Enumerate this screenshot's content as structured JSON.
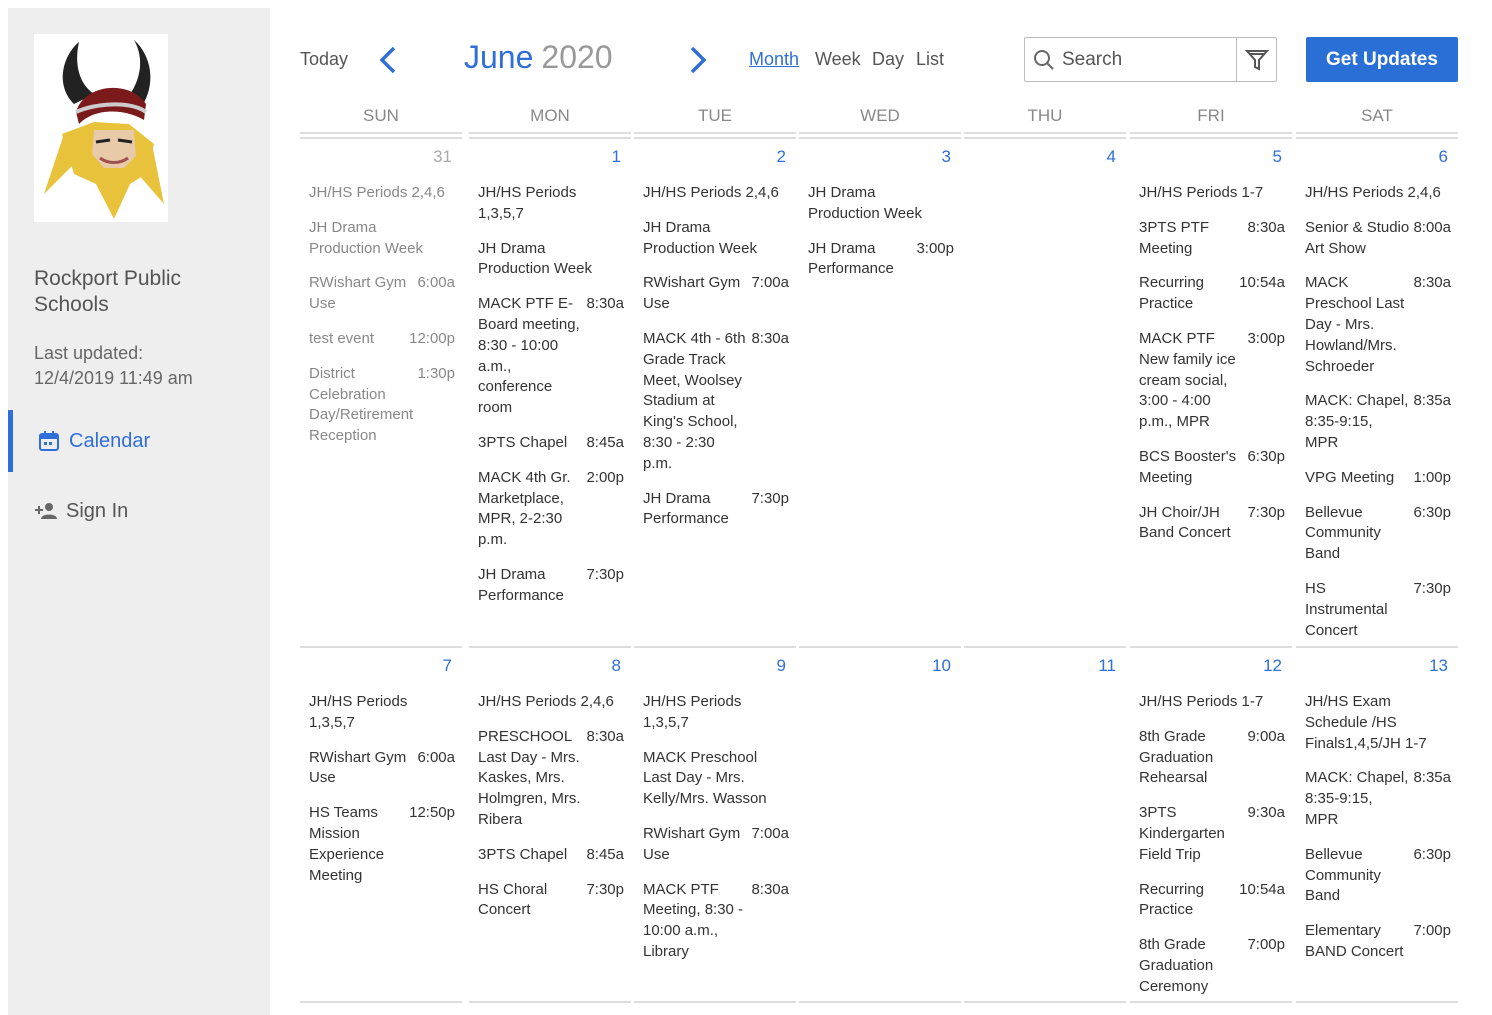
{
  "sidebar": {
    "org_name": "Rockport Public Schools",
    "updated_label": "Last updated:",
    "updated_value": "12/4/2019 11:49 am",
    "nav": [
      {
        "label": "Calendar",
        "icon": "calendar-icon"
      },
      {
        "label": "Sign In",
        "icon": "person-add-icon"
      }
    ]
  },
  "toolbar": {
    "today": "Today",
    "month": "June",
    "year": "2020",
    "views": [
      "Month",
      "Week",
      "Day",
      "List"
    ],
    "active_view": "Month",
    "search_placeholder": "Search",
    "updates_button": "Get Updates"
  },
  "colors": {
    "accent": "#2f6fd8",
    "button": "#2a6fd6",
    "sidebar_bg": "#eeeeee"
  },
  "weekdays": [
    "SUN",
    "MON",
    "TUE",
    "WED",
    "THU",
    "FRI",
    "SAT"
  ],
  "weeks": [
    [
      {
        "num": "31",
        "muted": true,
        "events": [
          {
            "title": "JH/HS Periods 2,4,6",
            "time": ""
          },
          {
            "title": "JH Drama Production Week",
            "time": ""
          },
          {
            "title": "RWishart Gym Use",
            "time": "6:00a"
          },
          {
            "title": "test event",
            "time": "12:00p"
          },
          {
            "title": "District Celebration Day/Retirement Reception",
            "time": "1:30p"
          }
        ]
      },
      {
        "num": "1",
        "events": [
          {
            "title": "JH/HS Periods 1,3,5,7",
            "time": ""
          },
          {
            "title": "JH Drama Production Week",
            "time": ""
          },
          {
            "title": "MACK PTF E-Board meeting, 8:30 - 10:00 a.m., conference room",
            "time": "8:30a"
          },
          {
            "title": "3PTS Chapel",
            "time": "8:45a"
          },
          {
            "title": "MACK 4th Gr. Marketplace, MPR, 2-2:30 p.m.",
            "time": "2:00p"
          },
          {
            "title": "JH Drama Performance",
            "time": "7:30p"
          }
        ]
      },
      {
        "num": "2",
        "events": [
          {
            "title": "JH/HS Periods 2,4,6",
            "time": ""
          },
          {
            "title": "JH Drama Production Week",
            "time": ""
          },
          {
            "title": "RWishart Gym Use",
            "time": "7:00a"
          },
          {
            "title": "MACK 4th - 6th Grade Track Meet, Woolsey Stadium at King's School, 8:30 - 2:30 p.m.",
            "time": "8:30a"
          },
          {
            "title": "JH Drama Performance",
            "time": "7:30p"
          }
        ]
      },
      {
        "num": "3",
        "events": [
          {
            "title": "JH Drama Production Week",
            "time": ""
          },
          {
            "title": "JH Drama Performance",
            "time": "3:00p"
          }
        ]
      },
      {
        "num": "4",
        "events": []
      },
      {
        "num": "5",
        "events": [
          {
            "title": "JH/HS Periods 1-7",
            "time": ""
          },
          {
            "title": "3PTS PTF Meeting",
            "time": "8:30a"
          },
          {
            "title": "Recurring Practice",
            "time": "10:54a"
          },
          {
            "title": "MACK PTF New family ice cream social, 3:00 - 4:00 p.m., MPR",
            "time": "3:00p"
          },
          {
            "title": "BCS Booster's Meeting",
            "time": "6:30p"
          },
          {
            "title": "JH Choir/JH Band Concert",
            "time": "7:30p"
          }
        ]
      },
      {
        "num": "6",
        "events": [
          {
            "title": "JH/HS Periods 2,4,6",
            "time": ""
          },
          {
            "title": "Senior & Studio Art Show",
            "time": "8:00a"
          },
          {
            "title": "MACK Preschool Last Day - Mrs. Howland/Mrs. Schroeder",
            "time": "8:30a"
          },
          {
            "title": "MACK: Chapel, 8:35-9:15, MPR",
            "time": "8:35a"
          },
          {
            "title": "VPG Meeting",
            "time": "1:00p"
          },
          {
            "title": "Bellevue Community Band",
            "time": "6:30p"
          },
          {
            "title": "HS Instrumental Concert",
            "time": "7:30p"
          }
        ]
      }
    ],
    [
      {
        "num": "7",
        "events": [
          {
            "title": "JH/HS Periods 1,3,5,7",
            "time": ""
          },
          {
            "title": "RWishart Gym Use",
            "time": "6:00a"
          },
          {
            "title": "HS Teams Mission Experience Meeting",
            "time": "12:50p"
          }
        ]
      },
      {
        "num": "8",
        "events": [
          {
            "title": "JH/HS Periods 2,4,6",
            "time": ""
          },
          {
            "title": "PRESCHOOL Last Day - Mrs. Kaskes, Mrs. Holmgren, Mrs. Ribera",
            "time": "8:30a"
          },
          {
            "title": "3PTS Chapel",
            "time": "8:45a"
          },
          {
            "title": "HS Choral Concert",
            "time": "7:30p"
          }
        ]
      },
      {
        "num": "9",
        "events": [
          {
            "title": "JH/HS Periods 1,3,5,7",
            "time": ""
          },
          {
            "title": "MACK Preschool Last Day - Mrs. Kelly/Mrs. Wasson",
            "time": ""
          },
          {
            "title": "RWishart Gym Use",
            "time": "7:00a"
          },
          {
            "title": "MACK PTF Meeting, 8:30 - 10:00 a.m., Library",
            "time": "8:30a"
          }
        ]
      },
      {
        "num": "10",
        "events": []
      },
      {
        "num": "11",
        "events": []
      },
      {
        "num": "12",
        "events": [
          {
            "title": "JH/HS Periods 1-7",
            "time": ""
          },
          {
            "title": "8th Grade Graduation Rehearsal",
            "time": "9:00a"
          },
          {
            "title": "3PTS Kindergarten Field Trip",
            "time": "9:30a"
          },
          {
            "title": "Recurring Practice",
            "time": "10:54a"
          },
          {
            "title": "8th Grade Graduation Ceremony",
            "time": "7:00p"
          }
        ]
      },
      {
        "num": "13",
        "events": [
          {
            "title": "JH/HS Exam Schedule /HS Finals1,4,5/JH 1-7",
            "time": ""
          },
          {
            "title": "MACK: Chapel, 8:35-9:15, MPR",
            "time": "8:35a"
          },
          {
            "title": "Bellevue Community Band",
            "time": "6:30p"
          },
          {
            "title": "Elementary BAND Concert",
            "time": "7:00p"
          }
        ]
      }
    ]
  ]
}
